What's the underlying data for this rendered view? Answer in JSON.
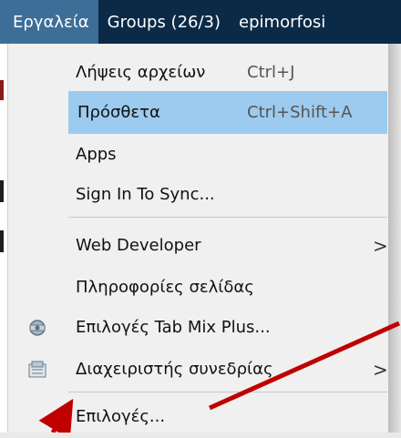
{
  "menubar": {
    "items": [
      "Εργαλεία",
      "Groups (26/3)",
      "epimorfosi"
    ]
  },
  "tools_menu": {
    "items": [
      {
        "label": "Λήψεις αρχείων",
        "shortcut": "Ctrl+J"
      },
      {
        "label": "Πρόσθετα",
        "shortcut": "Ctrl+Shift+A",
        "highlighted": true
      },
      {
        "label": "Apps"
      },
      {
        "label": "Sign In To Sync..."
      },
      {
        "label": "Web Developer",
        "submenu": true
      },
      {
        "label": "Πληροφορίες σελίδας"
      },
      {
        "label": "Επιλογές Tab Mix Plus...",
        "icon": "gear-icon"
      },
      {
        "label": "Διαχειριστής συνεδρίας",
        "icon": "sessions-icon",
        "submenu": true
      },
      {
        "label": "Επιλογές..."
      }
    ],
    "submenu_arrow": ">"
  },
  "annotation_color": "#c00000"
}
